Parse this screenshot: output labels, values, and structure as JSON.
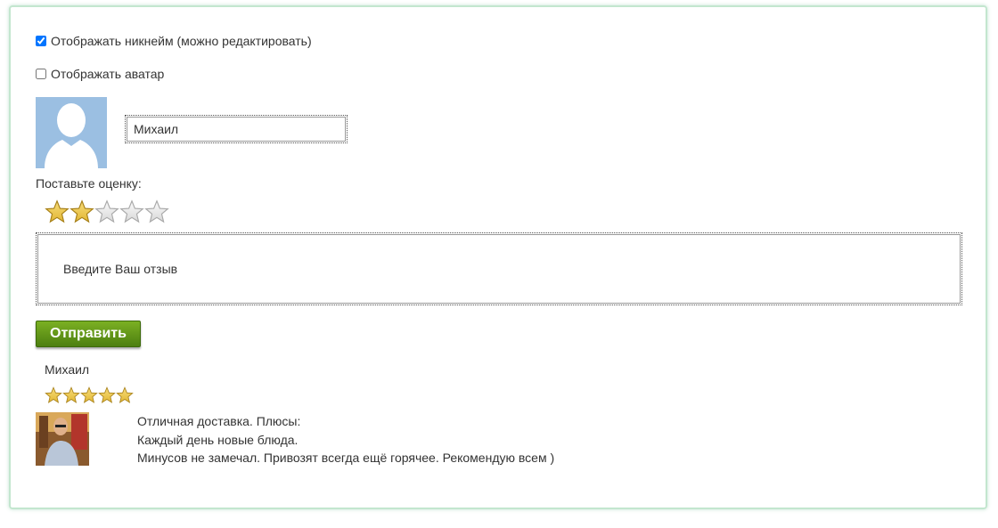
{
  "options": {
    "show_nickname": {
      "label": "Отображать никнейм (можно редактировать)",
      "checked": true
    },
    "show_avatar": {
      "label": "Отображать аватар",
      "checked": false
    }
  },
  "profile": {
    "avatar_icon": "user-silhouette-icon",
    "nickname_value": "Михаил"
  },
  "rating": {
    "label": "Поставьте оценку:",
    "value": 2,
    "max": 5
  },
  "review_form": {
    "placeholder": "Введите Ваш отзыв",
    "submit_label": "Отправить"
  },
  "reviews": [
    {
      "author": "Михаил",
      "rating": 5,
      "lines": [
        "Отличная доставка. Плюсы:",
        "Каждый день новые блюда.",
        "Минусов не замечал. Привозят всегда ещё горячее. Рекомендую всем )"
      ]
    }
  ],
  "colors": {
    "panel_border": "#c3e6cf",
    "button": "#5f9418",
    "star_filled": "#e2b734",
    "star_empty": "#d8d8d8",
    "avatar_bg": "#9bbfe2"
  }
}
